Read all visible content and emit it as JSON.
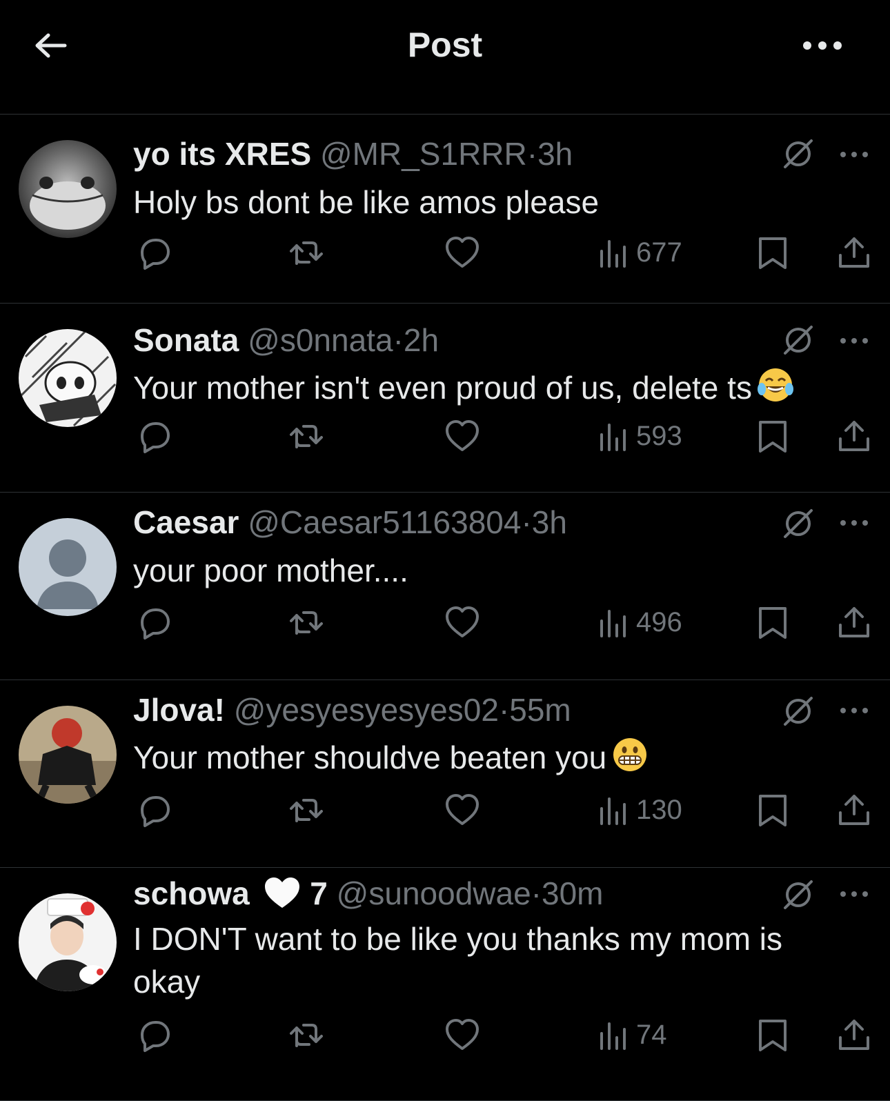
{
  "header": {
    "title": "Post"
  },
  "replies": [
    {
      "name": "yo its XRES",
      "handle": "@MR_S1RRR",
      "time": "3h",
      "text": "Holy bs dont be like amos please",
      "views": "677"
    },
    {
      "name": "Sonata",
      "handle": "@s0nnata",
      "time": "2h",
      "text": "Your mother isn't even proud of us, delete ts",
      "views": "593",
      "emoji": "tears-of-joy"
    },
    {
      "name": "Caesar",
      "handle": "@Caesar51163804",
      "time": "3h",
      "text": "your poor mother....",
      "views": "496"
    },
    {
      "name": "Jlova!",
      "handle": "@yesyesyesyes02",
      "time": "55m",
      "text": "Your mother shouldve beaten you",
      "views": "130",
      "emoji": "grimacing"
    },
    {
      "name": "schowa",
      "name_suffix": "7",
      "handle": "@sunoodwae",
      "time": "30m",
      "text": "I DON'T want to be like you thanks my mom is okay",
      "views": "74"
    }
  ],
  "separator": "·",
  "colors": {
    "background": "#000000",
    "text": "#e7e9ea",
    "muted": "#71767b",
    "divider": "#2f3336"
  }
}
